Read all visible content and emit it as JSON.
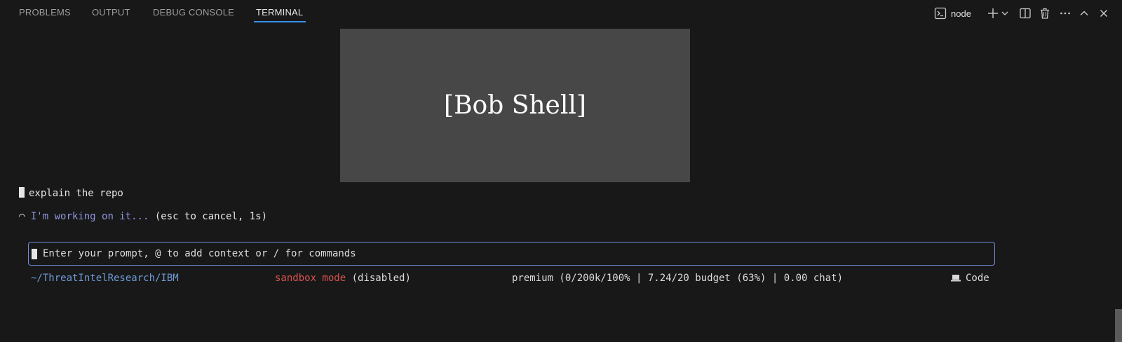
{
  "tabs": [
    {
      "label": "PROBLEMS"
    },
    {
      "label": "OUTPUT"
    },
    {
      "label": "DEBUG CONSOLE"
    },
    {
      "label": "TERMINAL",
      "active": true
    }
  ],
  "toolbar": {
    "terminal_name": "node",
    "icons": [
      "terminal-icon",
      "plus-icon",
      "chevron-down-icon",
      "split-icon",
      "trash-icon",
      "more-icon",
      "chevron-up-icon",
      "close-icon"
    ]
  },
  "placeholder": {
    "text": "[Bob Shell]"
  },
  "terminal": {
    "user_message": "explain the repo",
    "spinner": "◠",
    "working_text": "I'm working on it...",
    "working_hint": " (esc to cancel, 1s)"
  },
  "prompt": {
    "placeholder": "Enter your prompt, @ to add context or / for commands"
  },
  "status_bar": {
    "path": "~/ThreatIntelResearch/IBM",
    "sandbox_label": "sandbox mode",
    "sandbox_state": " (disabled)",
    "usage": "premium (0/200k/100% | 7.24/20 budget (63%) | 0.00 chat)",
    "mode": "Code"
  },
  "colors": {
    "accent": "#3794ff",
    "path": "#6f9bd9",
    "working": "#8e96e0",
    "sandbox": "#d9534f",
    "prompt_border": "#6f8fd8"
  }
}
